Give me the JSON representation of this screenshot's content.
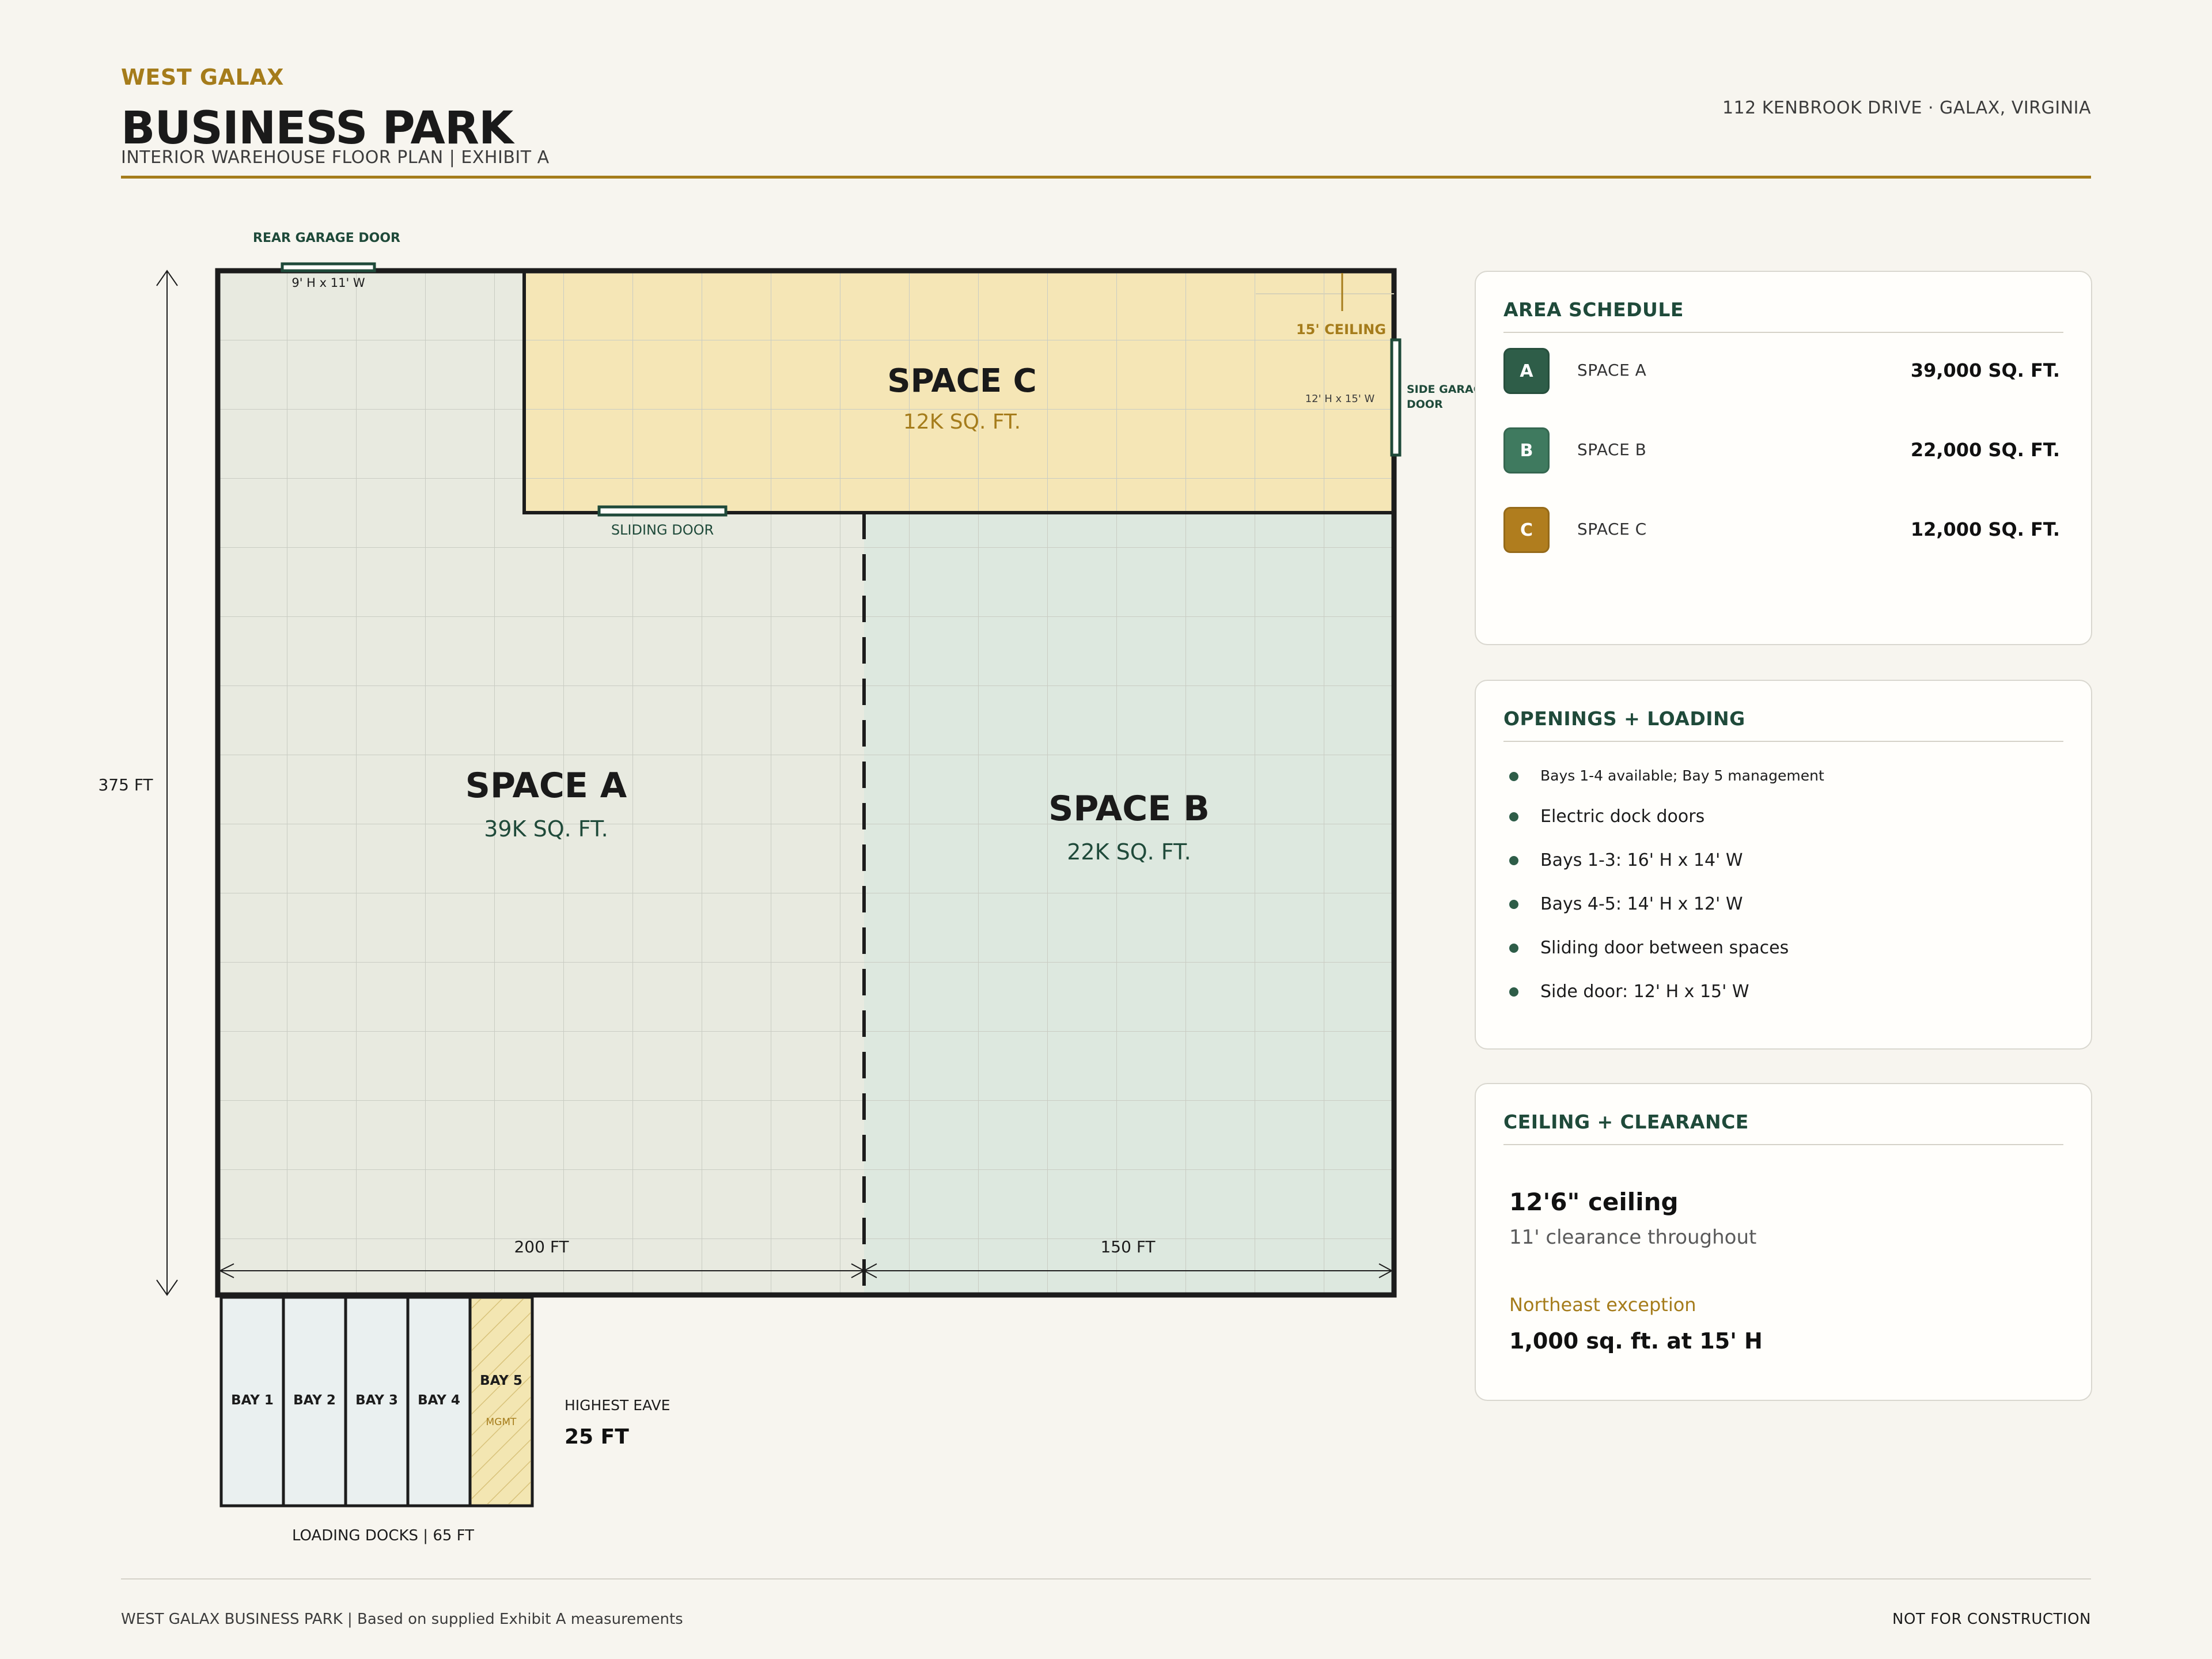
{
  "header": {
    "brand": "WEST GALAX",
    "title": "BUSINESS PARK",
    "subtitle": "INTERIOR WAREHOUSE FLOOR PLAN  |  EXHIBIT A",
    "address": "112 KENBROOK DRIVE  ·  GALAX, VIRGINIA"
  },
  "plan": {
    "colors": {
      "space_a": "#e8eae0",
      "space_b": "#dde8df",
      "space_c": "#f5e6b6",
      "wall": "#1c1c1c",
      "door": "#1f4a3a",
      "accent_gold": "#a57c1b",
      "dock_fill": "#eaf0f0",
      "mgmt_fill": "#f3e6b2"
    },
    "space_a": {
      "name": "SPACE A",
      "area": "39K SQ. FT."
    },
    "space_b": {
      "name": "SPACE B",
      "area": "22K SQ. FT."
    },
    "space_c": {
      "name": "SPACE C",
      "area": "12K SQ. FT."
    },
    "rear_door": {
      "label": "REAR GARAGE DOOR",
      "size": "9' H x 11' W"
    },
    "sliding_door": {
      "label": "SLIDING DOOR"
    },
    "side_door": {
      "label_line1": "SIDE GARAGE",
      "label_line2": "DOOR",
      "size": "12' H x 15' W"
    },
    "ceiling_callout": "15' CEILING",
    "dims": {
      "height": "375 FT",
      "width_a": "200 FT",
      "width_b": "150 FT"
    },
    "bays": [
      {
        "label": "BAY 1"
      },
      {
        "label": "BAY 2"
      },
      {
        "label": "BAY 3"
      },
      {
        "label": "BAY 4"
      },
      {
        "label": "BAY 5",
        "sub": "MGMT"
      }
    ],
    "docks_caption": "LOADING DOCKS  |  65 FT",
    "eave": {
      "label": "HIGHEST EAVE",
      "value": "25 FT"
    }
  },
  "area_schedule": {
    "title": "AREA SCHEDULE",
    "rows": [
      {
        "badge": "A",
        "label": "SPACE A",
        "value": "39,000 SQ. FT.",
        "color": "#2e5d48"
      },
      {
        "badge": "B",
        "label": "SPACE B",
        "value": "22,000 SQ. FT.",
        "color": "#3f7a5f"
      },
      {
        "badge": "C",
        "label": "SPACE C",
        "value": "12,000 SQ. FT.",
        "color": "#b07d1e"
      }
    ]
  },
  "openings": {
    "title": "OPENINGS + LOADING",
    "items": [
      "Bays 1-4 available; Bay 5 management",
      "Electric dock doors",
      "Bays 1-3: 16' H x 14' W",
      "Bays 4-5: 14' H x 12' W",
      "Sliding door between spaces",
      "Side door: 12' H x 15' W"
    ]
  },
  "ceiling": {
    "title": "CEILING + CLEARANCE",
    "main": "12'6\" ceiling",
    "sub": "11' clearance throughout",
    "exception_label": "Northeast exception",
    "exception_value": "1,000 sq. ft. at 15' H"
  },
  "footer": {
    "left": "WEST GALAX BUSINESS PARK  |  Based on supplied Exhibit A measurements",
    "right": "NOT FOR CONSTRUCTION"
  }
}
